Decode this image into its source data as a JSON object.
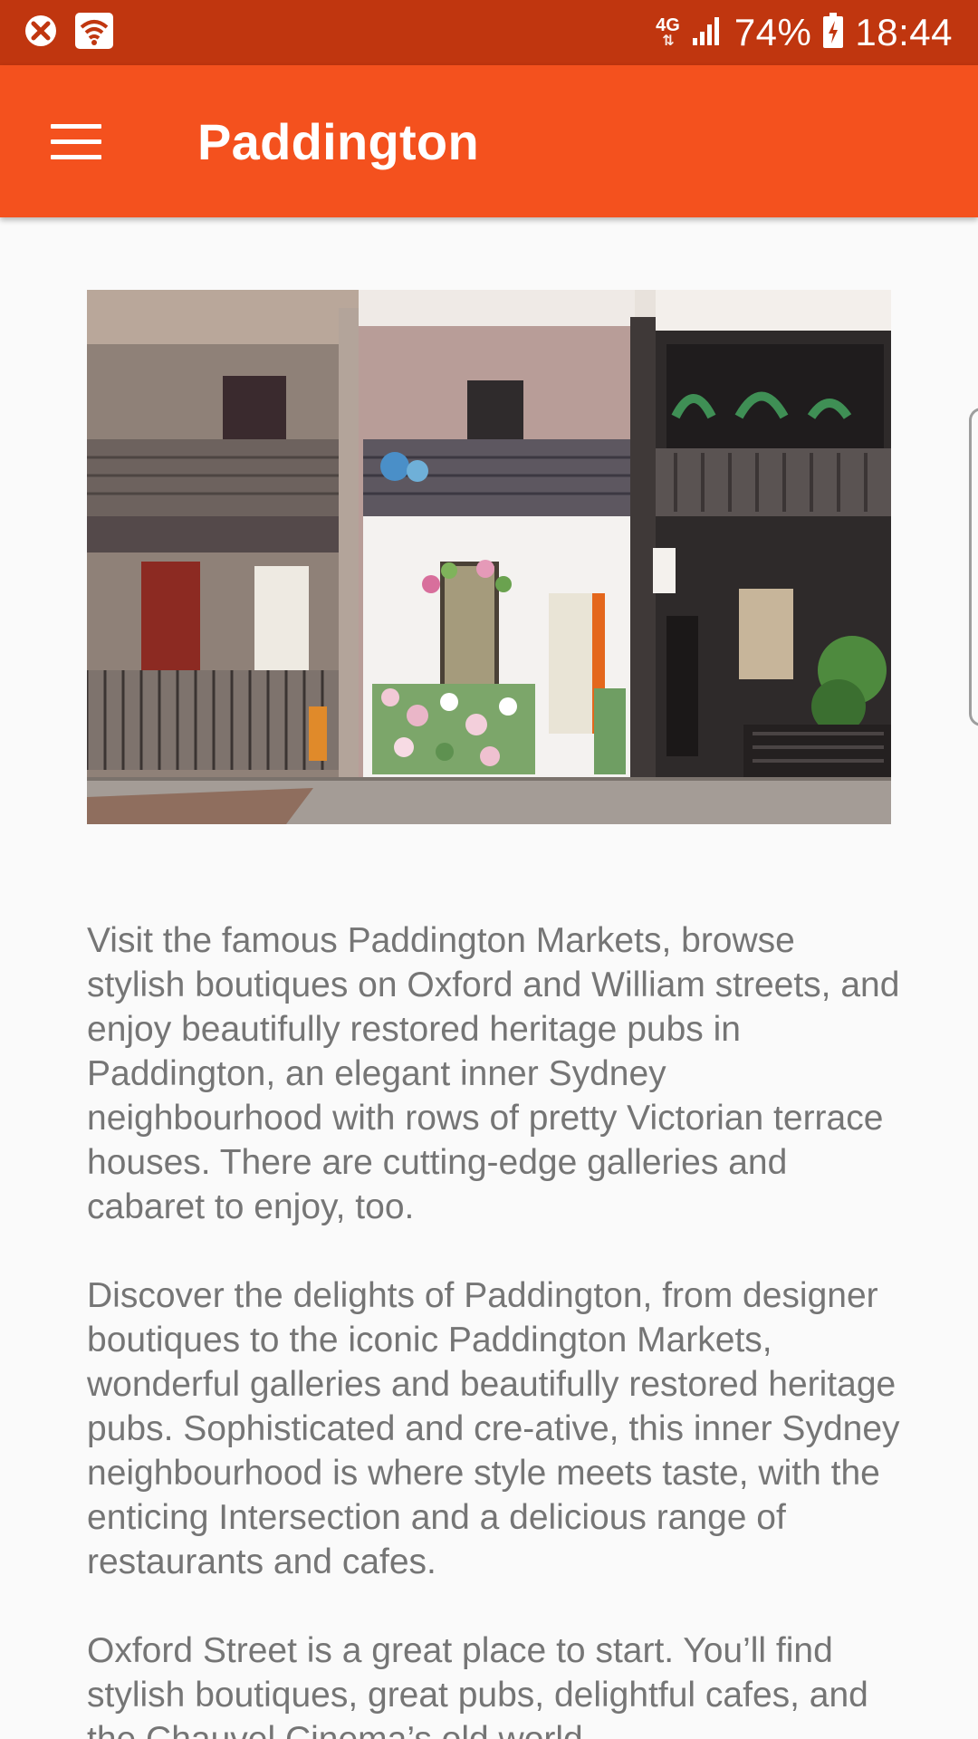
{
  "status_bar": {
    "network_type": "4G",
    "battery": "74%",
    "time": "18:44",
    "icons": [
      "blocked-notification-icon",
      "wifi-hotspot-icon",
      "signal-icon",
      "battery-charging-icon"
    ]
  },
  "app_bar": {
    "title": "Paddington",
    "menu_icon": "hamburger-menu-icon",
    "color": "#f4511e",
    "status_color": "#c0360f"
  },
  "hero": {
    "description_icon": "terrace-houses-photo"
  },
  "article": {
    "paragraphs": [
      "Visit the famous Paddington Markets, browse stylish boutiques on Oxford and William streets, and enjoy beautifully restored heritage pubs in Paddington, an elegant inner Sydney neighbourhood with rows of pretty Victorian terrace houses. There are cutting-edge galleries and cabaret to enjoy, too.",
      "Discover the delights of Paddington, from designer boutiques to the iconic Paddington Markets, wonderful galleries and beautifully restored heritage pubs. Sophisticated and cre-ative, this inner Sydney neighbourhood is where style meets taste, with the enticing Intersection and a delicious range of restaurants and cafes.",
      "Oxford Street is a great place to start. You’ll find stylish boutiques, great pubs, delightful cafes, and the Chauvel Cinema’s old world"
    ]
  }
}
